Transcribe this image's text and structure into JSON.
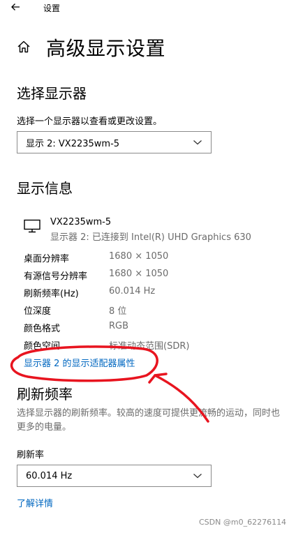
{
  "titlebar": {
    "back_icon": "back-arrow-icon",
    "title": "设置"
  },
  "header": {
    "home_icon": "home-icon",
    "title": "高级显示设置"
  },
  "select_display": {
    "section_title": "选择显示器",
    "instruction": "选择一个显示器以查看或更改设置。",
    "selected": "显示 2: VX2235wm-5"
  },
  "display_info": {
    "section_title": "显示信息",
    "monitor_icon": "monitor-icon",
    "monitor_name": "VX2235wm-5",
    "monitor_sub": "显示器 2: 已连接到 Intel(R) UHD Graphics 630",
    "rows": [
      {
        "key": "桌面分辨率",
        "value": "1680 × 1050"
      },
      {
        "key": "有源信号分辨率",
        "value": "1680 × 1050"
      },
      {
        "key": "刷新频率(Hz)",
        "value": "60.014 Hz"
      },
      {
        "key": "位深度",
        "value": "8 位"
      },
      {
        "key": "颜色格式",
        "value": "RGB"
      },
      {
        "key": "颜色空间",
        "value": "标准动态范围(SDR)"
      }
    ],
    "adapter_link": "显示器 2 的显示适配器属性"
  },
  "refresh_rate": {
    "section_title": "刷新频率",
    "description_line1": "选择显示器的刷新频率。较高的速度可提供更流畅的运动，同时也",
    "description_line2": "更多的电量。",
    "field_label": "刷新率",
    "selected": "60.014 Hz",
    "learn_more": "了解详情"
  },
  "annotation": {
    "color": "#e8141f"
  },
  "watermark": "CSDN @m0_62276114"
}
